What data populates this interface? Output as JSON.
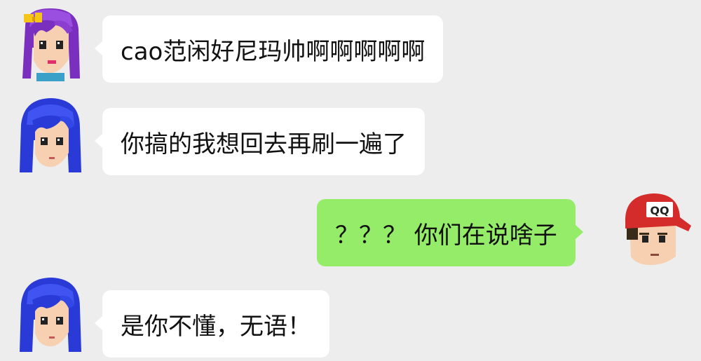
{
  "colors": {
    "background": "#ededed",
    "incoming_bubble": "#ffffff",
    "outgoing_bubble": "#95ec69",
    "text": "#111111"
  },
  "messages": [
    {
      "sender": "purple-hair-girl",
      "direction": "incoming",
      "text": "cao范闲好尼玛帅啊啊啊啊啊"
    },
    {
      "sender": "blue-hair-girl",
      "direction": "incoming",
      "text": "你搞的我想回去再刷一遍了"
    },
    {
      "sender": "red-cap-boy",
      "direction": "outgoing",
      "text": "？？？ 你们在说啥子"
    },
    {
      "sender": "blue-hair-girl",
      "direction": "incoming",
      "text": "是你不懂，无语！"
    }
  ],
  "avatars": {
    "purple_hair_girl": "purple-hair-girl-avatar",
    "blue_hair_girl": "blue-hair-girl-avatar",
    "red_cap_boy": "red-cap-boy-avatar",
    "cap_text": "QQ"
  }
}
